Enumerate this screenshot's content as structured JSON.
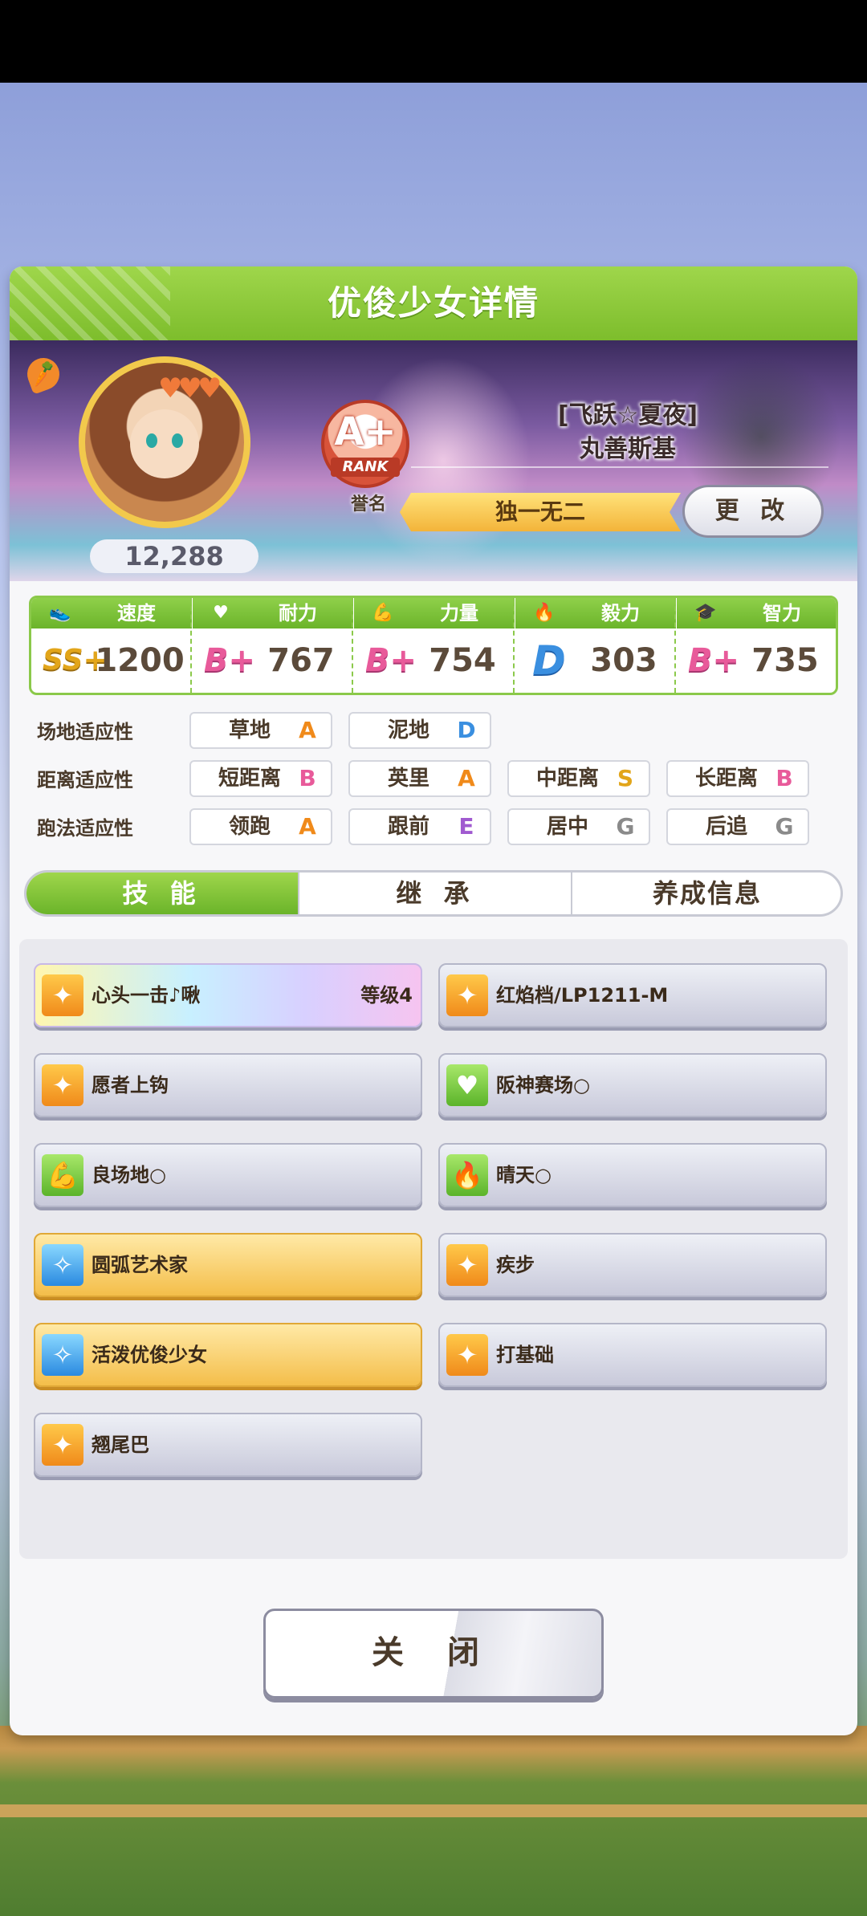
{
  "panel": {
    "title": "优俊少女详情"
  },
  "profile": {
    "score": "12,288",
    "rank_grade": "A+",
    "rank_word": "RANK",
    "fame_label": "誉名",
    "char_title": "[飞跃☆夏夜]",
    "char_name": "丸善斯基",
    "title_ribbon": "独一无二",
    "change_button": "更 改"
  },
  "stats": [
    {
      "label": "速度",
      "icon": "shoe-icon",
      "glyph": "👟",
      "grade": "SS+",
      "value": "1200"
    },
    {
      "label": "耐力",
      "icon": "heart-icon",
      "glyph": "♥",
      "grade": "B+",
      "value": "767"
    },
    {
      "label": "力量",
      "icon": "muscle-icon",
      "glyph": "💪",
      "grade": "B+",
      "value": "754"
    },
    {
      "label": "毅力",
      "icon": "flame-icon",
      "glyph": "🔥",
      "grade": "D",
      "value": "303"
    },
    {
      "label": "智力",
      "icon": "graduation-cap-icon",
      "glyph": "🎓",
      "grade": "B+",
      "value": "735"
    }
  ],
  "aptitude": {
    "track_label": "场地适应性",
    "distance_label": "距离适应性",
    "style_label": "跑法适应性",
    "track": [
      {
        "name": "草地",
        "grade": "A"
      },
      {
        "name": "泥地",
        "grade": "D"
      }
    ],
    "distance": [
      {
        "name": "短距离",
        "grade": "B"
      },
      {
        "name": "英里",
        "grade": "A"
      },
      {
        "name": "中距离",
        "grade": "S"
      },
      {
        "name": "长距离",
        "grade": "B"
      }
    ],
    "style": [
      {
        "name": "领跑",
        "grade": "A"
      },
      {
        "name": "跟前",
        "grade": "E"
      },
      {
        "name": "居中",
        "grade": "G"
      },
      {
        "name": "后追",
        "grade": "G"
      }
    ]
  },
  "tabs": [
    {
      "label": "技 能",
      "active": true
    },
    {
      "label": "继 承",
      "active": false
    },
    {
      "label": "养成信息",
      "active": false
    }
  ],
  "skills": [
    {
      "name": "心头一击♪啾",
      "level": "等级4",
      "style": "rainbow",
      "icon": "speed-skill-icon"
    },
    {
      "name": "红焰档/LP1211-M",
      "level": "",
      "style": "normal",
      "icon": "speed-skill-icon"
    },
    {
      "name": "愿者上钩",
      "level": "",
      "style": "normal",
      "icon": "speed-skill-icon"
    },
    {
      "name": "阪神赛场○",
      "level": "",
      "style": "normal",
      "icon": "stamina-skill-icon"
    },
    {
      "name": "良场地○",
      "level": "",
      "style": "normal",
      "icon": "power-skill-icon"
    },
    {
      "name": "晴天○",
      "level": "",
      "style": "normal",
      "icon": "flame-skill-icon"
    },
    {
      "name": "圆弧艺术家",
      "level": "",
      "style": "gold",
      "icon": "recovery-skill-icon"
    },
    {
      "name": "疾步",
      "level": "",
      "style": "normal",
      "icon": "speed-skill-icon"
    },
    {
      "name": "活泼优俊少女",
      "level": "",
      "style": "gold",
      "icon": "recovery-skill-icon"
    },
    {
      "name": "打基础",
      "level": "",
      "style": "normal",
      "icon": "speed-skill-icon"
    },
    {
      "name": "翘尾巴",
      "level": "",
      "style": "normal",
      "icon": "speed-skill-icon"
    }
  ],
  "close_button": "关 闭",
  "colors": {
    "accent_green": "#7dbd2c",
    "gold": "#f4be4a",
    "pink_grade": "#e85a9a",
    "blue_grade": "#3a8fe0"
  }
}
